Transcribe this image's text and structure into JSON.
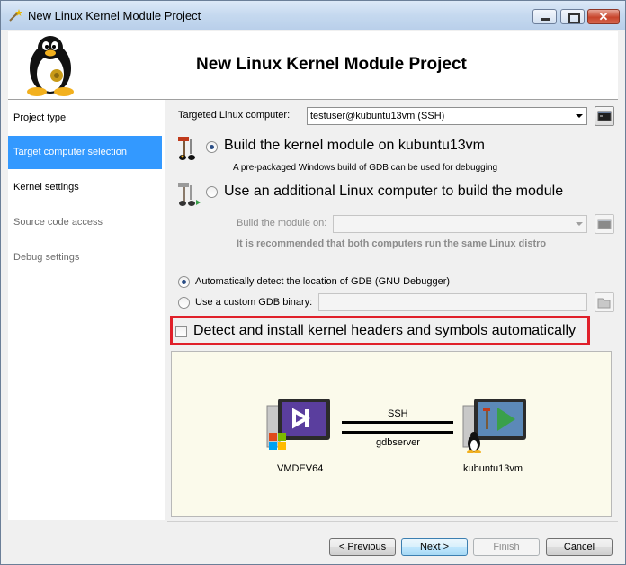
{
  "window": {
    "title": "New Linux Kernel Module Project"
  },
  "banner": {
    "title": "New Linux Kernel Module Project",
    "logo_icon": "tux-penguin-icon"
  },
  "sidebar": {
    "items": [
      {
        "label": "Project type",
        "state": "normal"
      },
      {
        "label": "Target computer selection",
        "state": "selected"
      },
      {
        "label": "Kernel settings",
        "state": "normal"
      },
      {
        "label": "Source code access",
        "state": "disabled"
      },
      {
        "label": "Debug settings",
        "state": "disabled"
      }
    ]
  },
  "target": {
    "label": "Targeted Linux computer:",
    "value": "testuser@kubuntu13vm (SSH)"
  },
  "build_options": {
    "on_target_label": "Build the kernel module on kubuntu13vm",
    "on_target_hint": "A pre-packaged Windows build of GDB can be used for debugging",
    "on_target_checked": true,
    "additional_label": "Use an additional Linux computer to build the module",
    "additional_checked": false,
    "build_on_label": "Build the module on:",
    "build_on_value": "",
    "recommend_note": "It is recommended that both computers run the same Linux distro"
  },
  "gdb": {
    "auto_label": "Automatically detect the location of GDB (GNU Debugger)",
    "auto_checked": true,
    "custom_label": "Use a custom GDB binary:",
    "custom_checked": false,
    "custom_value": ""
  },
  "kernel_headers": {
    "label": "Detect and install kernel headers and symbols automatically",
    "checked": false,
    "highlight_color": "#e0202a"
  },
  "diagram": {
    "left_host": "VMDEV64",
    "right_host": "kubuntu13vm",
    "top_link": "SSH",
    "bottom_link": "gdbserver"
  },
  "buttons": {
    "previous": "< Previous",
    "next": "Next >",
    "finish": "Finish",
    "cancel": "Cancel"
  },
  "colors": {
    "selection": "#3399ff",
    "banner_bg": "#ffffff",
    "diagram_bg": "#fbfaeb"
  }
}
